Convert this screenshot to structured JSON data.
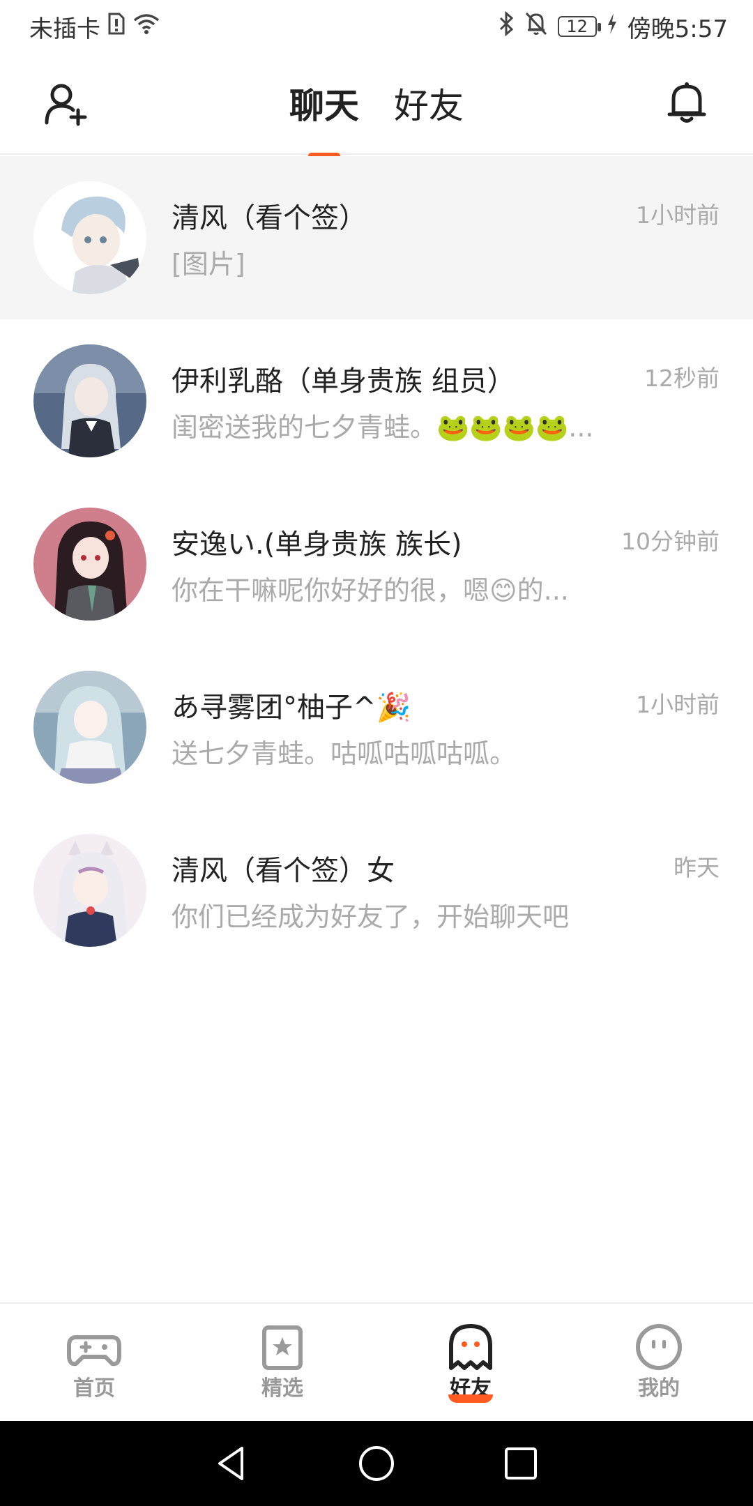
{
  "status_bar": {
    "carrier": "未插卡",
    "battery": "12",
    "time": "傍晚5:57"
  },
  "top_nav": {
    "tabs": [
      {
        "label": "聊天",
        "active": true
      },
      {
        "label": "好友",
        "active": false
      }
    ]
  },
  "chats": [
    {
      "name": "清风（看个签）",
      "time": "1小时前",
      "message": "[图片]",
      "avatar_color": "#e9eef4",
      "highlight": true
    },
    {
      "name": "伊利乳酪（单身贵族 组员）",
      "time": "12秒前",
      "message": "闺密送我的七夕青蛙。🐸🐸🐸🐸...",
      "avatar_color": "#566a88",
      "highlight": false
    },
    {
      "name": "安逸い.(单身贵族 族长)",
      "time": "10分钟前",
      "message": "你在干嘛呢你好好的很，嗯😊的...",
      "avatar_color": "#cf7e8c",
      "highlight": false
    },
    {
      "name": "あ寻雾团°柚子^🎉",
      "time": "1小时前",
      "message": "送七夕青蛙。咕呱咕呱咕呱。",
      "avatar_color": "#8aa6b8",
      "highlight": false
    },
    {
      "name": "清风（看个签）女",
      "time": "昨天",
      "message": "你们已经成为好友了，开始聊天吧",
      "avatar_color": "#e7dde6",
      "highlight": false
    }
  ],
  "bottom_nav": {
    "items": [
      {
        "label": "首页",
        "active": false
      },
      {
        "label": "精选",
        "active": false
      },
      {
        "label": "好友",
        "active": true
      },
      {
        "label": "我的",
        "active": false
      }
    ]
  },
  "colors": {
    "accent": "#ff5a1f",
    "muted_text": "#aaaaaa",
    "highlight_bg": "#f5f5f5"
  }
}
